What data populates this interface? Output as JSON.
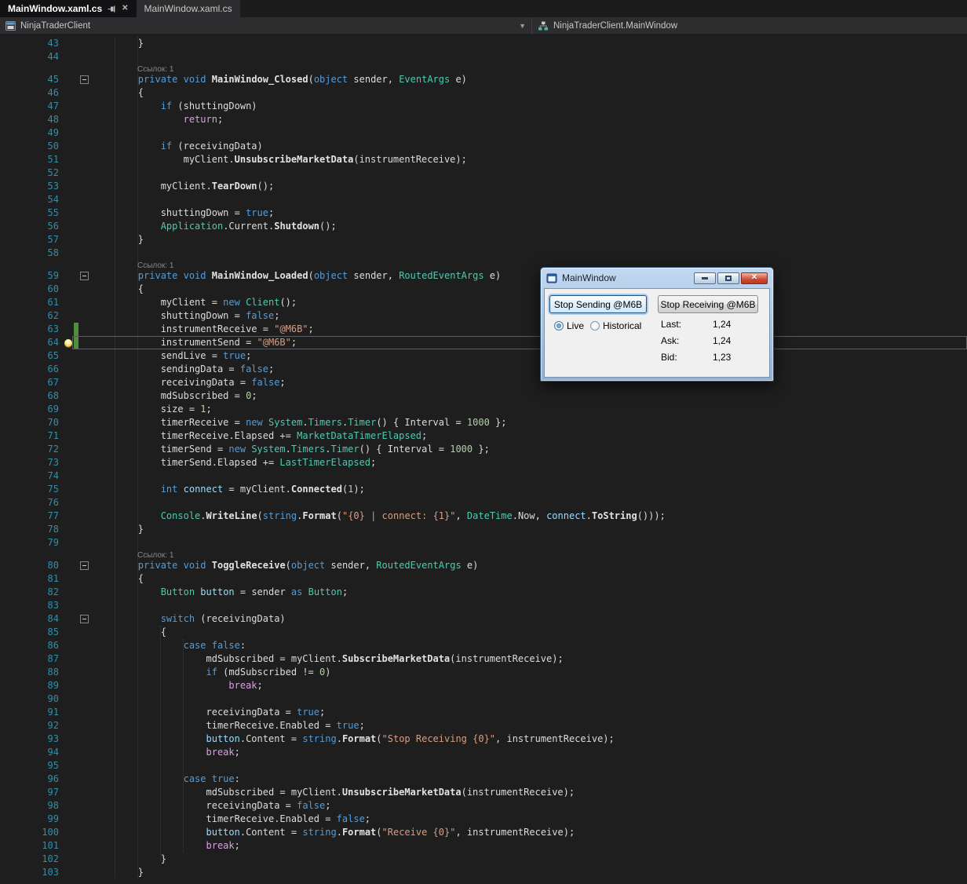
{
  "tabs": [
    {
      "label": "MainWindow.xaml.cs"
    },
    {
      "label": "MainWindow.xaml.cs"
    }
  ],
  "navbar": {
    "project": "NinjaTraderClient",
    "type": "NinjaTraderClient.MainWindow"
  },
  "colors": {
    "kw": "#569cd6",
    "ctrl": "#d8a0df",
    "type": "#4ec9b0",
    "method": "#e2e2e2",
    "str": "#d69d85",
    "num": "#b5cea8",
    "plain": "#dcdcdc",
    "local": "#9cdcfe",
    "lineno": "#2b91af",
    "editorBg": "#1e1e1e",
    "track": "#4e8f3c",
    "close": "#cf4b32"
  },
  "editor": {
    "codelens_label": "Ссылок: 1",
    "rows": [
      {
        "n": "43",
        "t": [
          [
            "p",
            "        }"
          ]
        ]
      },
      {
        "n": "44",
        "t": []
      },
      {
        "lens": true
      },
      {
        "n": "45",
        "fold": true,
        "t": [
          [
            "p",
            "        "
          ],
          [
            "k",
            "private"
          ],
          [
            "p",
            " "
          ],
          [
            "k",
            "void"
          ],
          [
            "p",
            " "
          ],
          [
            "m",
            "MainWindow_Closed"
          ],
          [
            "p",
            "("
          ],
          [
            "k",
            "object"
          ],
          [
            "p",
            " sender, "
          ],
          [
            "t",
            "EventArgs"
          ],
          [
            "p",
            " e)"
          ]
        ]
      },
      {
        "n": "46",
        "t": [
          [
            "p",
            "        {"
          ]
        ]
      },
      {
        "n": "47",
        "t": [
          [
            "p",
            "            "
          ],
          [
            "k",
            "if"
          ],
          [
            "p",
            " (shuttingDown)"
          ]
        ]
      },
      {
        "n": "48",
        "t": [
          [
            "p",
            "                "
          ],
          [
            "c",
            "return"
          ],
          [
            "p",
            ";"
          ]
        ]
      },
      {
        "n": "49",
        "t": []
      },
      {
        "n": "50",
        "t": [
          [
            "p",
            "            "
          ],
          [
            "k",
            "if"
          ],
          [
            "p",
            " (receivingData)"
          ]
        ]
      },
      {
        "n": "51",
        "t": [
          [
            "p",
            "                myClient."
          ],
          [
            "m",
            "UnsubscribeMarketData"
          ],
          [
            "p",
            "(instrumentReceive);"
          ]
        ]
      },
      {
        "n": "52",
        "t": []
      },
      {
        "n": "53",
        "t": [
          [
            "p",
            "            myClient."
          ],
          [
            "m",
            "TearDown"
          ],
          [
            "p",
            "();"
          ]
        ]
      },
      {
        "n": "54",
        "t": []
      },
      {
        "n": "55",
        "t": [
          [
            "p",
            "            shuttingDown = "
          ],
          [
            "k",
            "true"
          ],
          [
            "p",
            ";"
          ]
        ]
      },
      {
        "n": "56",
        "t": [
          [
            "p",
            "            "
          ],
          [
            "t",
            "Application"
          ],
          [
            "p",
            ".Current."
          ],
          [
            "m",
            "Shutdown"
          ],
          [
            "p",
            "();"
          ]
        ]
      },
      {
        "n": "57",
        "t": [
          [
            "p",
            "        }"
          ]
        ]
      },
      {
        "n": "58",
        "t": []
      },
      {
        "lens": true
      },
      {
        "n": "59",
        "fold": true,
        "t": [
          [
            "p",
            "        "
          ],
          [
            "k",
            "private"
          ],
          [
            "p",
            " "
          ],
          [
            "k",
            "void"
          ],
          [
            "p",
            " "
          ],
          [
            "m",
            "MainWindow_Loaded"
          ],
          [
            "p",
            "("
          ],
          [
            "k",
            "object"
          ],
          [
            "p",
            " sender, "
          ],
          [
            "t",
            "RoutedEventArgs"
          ],
          [
            "p",
            " e)"
          ]
        ]
      },
      {
        "n": "60",
        "t": [
          [
            "p",
            "        {"
          ]
        ]
      },
      {
        "n": "61",
        "t": [
          [
            "p",
            "            myClient = "
          ],
          [
            "k",
            "new"
          ],
          [
            "p",
            " "
          ],
          [
            "t",
            "Client"
          ],
          [
            "p",
            "();"
          ]
        ]
      },
      {
        "n": "62",
        "t": [
          [
            "p",
            "            shuttingDown = "
          ],
          [
            "k",
            "false"
          ],
          [
            "p",
            ";"
          ]
        ]
      },
      {
        "n": "63",
        "trk": true,
        "t": [
          [
            "p",
            "            instrumentReceive = "
          ],
          [
            "s",
            "\"@M6B\""
          ],
          [
            "p",
            ";"
          ]
        ]
      },
      {
        "n": "64",
        "trk": true,
        "cur": true,
        "bulb": true,
        "t": [
          [
            "p",
            "            instrumentSend = "
          ],
          [
            "s",
            "\"@M6B\""
          ],
          [
            "p",
            ";"
          ]
        ]
      },
      {
        "n": "65",
        "t": [
          [
            "p",
            "            sendLive = "
          ],
          [
            "k",
            "true"
          ],
          [
            "p",
            ";"
          ]
        ]
      },
      {
        "n": "66",
        "t": [
          [
            "p",
            "            sendingData = "
          ],
          [
            "k",
            "false"
          ],
          [
            "p",
            ";"
          ]
        ]
      },
      {
        "n": "67",
        "t": [
          [
            "p",
            "            receivingData = "
          ],
          [
            "k",
            "false"
          ],
          [
            "p",
            ";"
          ]
        ]
      },
      {
        "n": "68",
        "t": [
          [
            "p",
            "            mdSubscribed = "
          ],
          [
            "n",
            "0"
          ],
          [
            "p",
            ";"
          ]
        ]
      },
      {
        "n": "69",
        "t": [
          [
            "p",
            "            size = "
          ],
          [
            "n",
            "1"
          ],
          [
            "p",
            ";"
          ]
        ]
      },
      {
        "n": "70",
        "t": [
          [
            "p",
            "            timerReceive = "
          ],
          [
            "k",
            "new"
          ],
          [
            "p",
            " "
          ],
          [
            "t",
            "System"
          ],
          [
            "p",
            "."
          ],
          [
            "t",
            "Timers"
          ],
          [
            "p",
            "."
          ],
          [
            "t",
            "Timer"
          ],
          [
            "p",
            "() { Interval = "
          ],
          [
            "n",
            "1000"
          ],
          [
            "p",
            " };"
          ]
        ]
      },
      {
        "n": "71",
        "t": [
          [
            "p",
            "            timerReceive.Elapsed += "
          ],
          [
            "t",
            "MarketDataTimerElapsed"
          ],
          [
            "p",
            ";"
          ]
        ]
      },
      {
        "n": "72",
        "t": [
          [
            "p",
            "            timerSend = "
          ],
          [
            "k",
            "new"
          ],
          [
            "p",
            " "
          ],
          [
            "t",
            "System"
          ],
          [
            "p",
            "."
          ],
          [
            "t",
            "Timers"
          ],
          [
            "p",
            "."
          ],
          [
            "t",
            "Timer"
          ],
          [
            "p",
            "() { Interval = "
          ],
          [
            "n",
            "1000"
          ],
          [
            "p",
            " };"
          ]
        ]
      },
      {
        "n": "73",
        "t": [
          [
            "p",
            "            timerSend.Elapsed += "
          ],
          [
            "t",
            "LastTimerElapsed"
          ],
          [
            "p",
            ";"
          ]
        ]
      },
      {
        "n": "74",
        "t": []
      },
      {
        "n": "75",
        "t": [
          [
            "p",
            "            "
          ],
          [
            "k",
            "int"
          ],
          [
            "p",
            " "
          ],
          [
            "v",
            "connect"
          ],
          [
            "p",
            " = myClient."
          ],
          [
            "m",
            "Connected"
          ],
          [
            "p",
            "("
          ],
          [
            "n",
            "1"
          ],
          [
            "p",
            ");"
          ]
        ]
      },
      {
        "n": "76",
        "t": []
      },
      {
        "n": "77",
        "t": [
          [
            "p",
            "            "
          ],
          [
            "t",
            "Console"
          ],
          [
            "p",
            "."
          ],
          [
            "m",
            "WriteLine"
          ],
          [
            "p",
            "("
          ],
          [
            "k",
            "string"
          ],
          [
            "p",
            "."
          ],
          [
            "m",
            "Format"
          ],
          [
            "p",
            "("
          ],
          [
            "s",
            "\"{0} | connect: {1}\""
          ],
          [
            "p",
            ", "
          ],
          [
            "t",
            "DateTime"
          ],
          [
            "p",
            ".Now, "
          ],
          [
            "v",
            "connect"
          ],
          [
            "p",
            "."
          ],
          [
            "m",
            "ToString"
          ],
          [
            "p",
            "()));"
          ]
        ]
      },
      {
        "n": "78",
        "t": [
          [
            "p",
            "        }"
          ]
        ]
      },
      {
        "n": "79",
        "t": []
      },
      {
        "lens": true
      },
      {
        "n": "80",
        "fold": true,
        "t": [
          [
            "p",
            "        "
          ],
          [
            "k",
            "private"
          ],
          [
            "p",
            " "
          ],
          [
            "k",
            "void"
          ],
          [
            "p",
            " "
          ],
          [
            "m",
            "ToggleReceive"
          ],
          [
            "p",
            "("
          ],
          [
            "k",
            "object"
          ],
          [
            "p",
            " sender, "
          ],
          [
            "t",
            "RoutedEventArgs"
          ],
          [
            "p",
            " e)"
          ]
        ]
      },
      {
        "n": "81",
        "t": [
          [
            "p",
            "        {"
          ]
        ]
      },
      {
        "n": "82",
        "t": [
          [
            "p",
            "            "
          ],
          [
            "t",
            "Button"
          ],
          [
            "p",
            " "
          ],
          [
            "v",
            "button"
          ],
          [
            "p",
            " = sender "
          ],
          [
            "k",
            "as"
          ],
          [
            "p",
            " "
          ],
          [
            "t",
            "Button"
          ],
          [
            "p",
            ";"
          ]
        ]
      },
      {
        "n": "83",
        "t": []
      },
      {
        "n": "84",
        "fold": true,
        "t": [
          [
            "p",
            "            "
          ],
          [
            "k",
            "switch"
          ],
          [
            "p",
            " (receivingData)"
          ]
        ]
      },
      {
        "n": "85",
        "t": [
          [
            "p",
            "            {"
          ]
        ]
      },
      {
        "n": "86",
        "t": [
          [
            "p",
            "                "
          ],
          [
            "k",
            "case"
          ],
          [
            "p",
            " "
          ],
          [
            "k",
            "false"
          ],
          [
            "p",
            ":"
          ]
        ]
      },
      {
        "n": "87",
        "t": [
          [
            "p",
            "                    mdSubscribed = myClient."
          ],
          [
            "m",
            "SubscribeMarketData"
          ],
          [
            "p",
            "(instrumentReceive);"
          ]
        ]
      },
      {
        "n": "88",
        "t": [
          [
            "p",
            "                    "
          ],
          [
            "k",
            "if"
          ],
          [
            "p",
            " (mdSubscribed != "
          ],
          [
            "n",
            "0"
          ],
          [
            "p",
            ")"
          ]
        ]
      },
      {
        "n": "89",
        "t": [
          [
            "p",
            "                        "
          ],
          [
            "c",
            "break"
          ],
          [
            "p",
            ";"
          ]
        ]
      },
      {
        "n": "90",
        "t": []
      },
      {
        "n": "91",
        "t": [
          [
            "p",
            "                    receivingData = "
          ],
          [
            "k",
            "true"
          ],
          [
            "p",
            ";"
          ]
        ]
      },
      {
        "n": "92",
        "t": [
          [
            "p",
            "                    timerReceive.Enabled = "
          ],
          [
            "k",
            "true"
          ],
          [
            "p",
            ";"
          ]
        ]
      },
      {
        "n": "93",
        "t": [
          [
            "p",
            "                    "
          ],
          [
            "v",
            "button"
          ],
          [
            "p",
            ".Content = "
          ],
          [
            "k",
            "string"
          ],
          [
            "p",
            "."
          ],
          [
            "m",
            "Format"
          ],
          [
            "p",
            "("
          ],
          [
            "s",
            "\"Stop Receiving {0}\""
          ],
          [
            "p",
            ", instrumentReceive);"
          ]
        ]
      },
      {
        "n": "94",
        "t": [
          [
            "p",
            "                    "
          ],
          [
            "c",
            "break"
          ],
          [
            "p",
            ";"
          ]
        ]
      },
      {
        "n": "95",
        "t": []
      },
      {
        "n": "96",
        "t": [
          [
            "p",
            "                "
          ],
          [
            "k",
            "case"
          ],
          [
            "p",
            " "
          ],
          [
            "k",
            "true"
          ],
          [
            "p",
            ":"
          ]
        ]
      },
      {
        "n": "97",
        "t": [
          [
            "p",
            "                    mdSubscribed = myClient."
          ],
          [
            "m",
            "UnsubscribeMarketData"
          ],
          [
            "p",
            "(instrumentReceive);"
          ]
        ]
      },
      {
        "n": "98",
        "t": [
          [
            "p",
            "                    receivingData = "
          ],
          [
            "k",
            "false"
          ],
          [
            "p",
            ";"
          ]
        ]
      },
      {
        "n": "99",
        "t": [
          [
            "p",
            "                    timerReceive.Enabled = "
          ],
          [
            "k",
            "false"
          ],
          [
            "p",
            ";"
          ]
        ]
      },
      {
        "n": "100",
        "t": [
          [
            "p",
            "                    "
          ],
          [
            "v",
            "button"
          ],
          [
            "p",
            ".Content = "
          ],
          [
            "k",
            "string"
          ],
          [
            "p",
            "."
          ],
          [
            "m",
            "Format"
          ],
          [
            "p",
            "("
          ],
          [
            "s",
            "\"Receive {0}\""
          ],
          [
            "p",
            ", instrumentReceive);"
          ]
        ]
      },
      {
        "n": "101",
        "t": [
          [
            "p",
            "                    "
          ],
          [
            "c",
            "break"
          ],
          [
            "p",
            ";"
          ]
        ]
      },
      {
        "n": "102",
        "t": [
          [
            "p",
            "            }"
          ]
        ]
      },
      {
        "n": "103",
        "t": [
          [
            "p",
            "        }"
          ]
        ]
      }
    ]
  },
  "app_window": {
    "title": "MainWindow",
    "send_button": "Stop Sending @M6B",
    "receive_button": "Stop Receiving @M6B",
    "radios": [
      {
        "label": "Live",
        "selected": true
      },
      {
        "label": "Historical",
        "selected": false
      }
    ],
    "quotes": [
      {
        "label": "Last:",
        "value": "1,24"
      },
      {
        "label": "Ask:",
        "value": "1,24"
      },
      {
        "label": "Bid:",
        "value": "1,23"
      }
    ]
  }
}
